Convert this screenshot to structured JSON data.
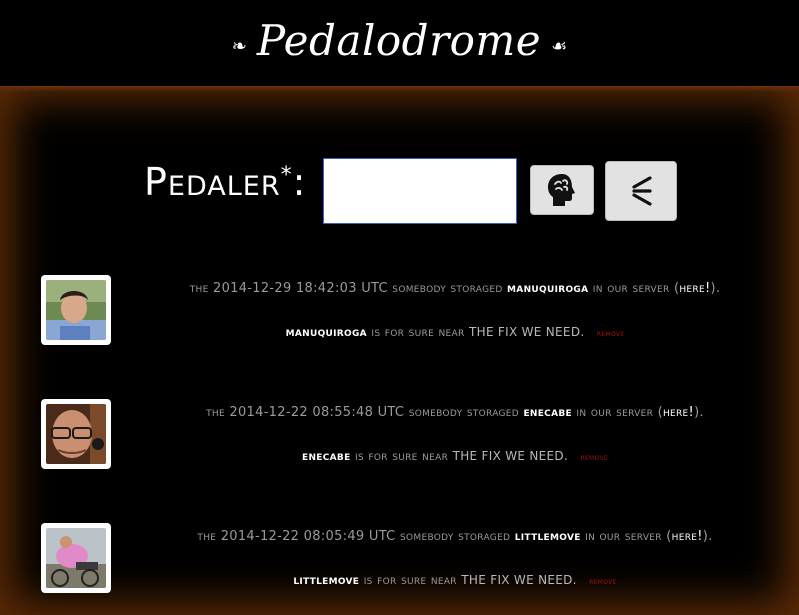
{
  "header": {
    "title": "Pedalodrome",
    "left_ornament": "❧",
    "right_ornament": "☙"
  },
  "form": {
    "label": "Pedaler",
    "required_mark": "*",
    "colon": ":",
    "input_value": "",
    "brain_button_icon": "brain-head-icon",
    "back_button_icon": "chevron-left-icon"
  },
  "entries": [
    {
      "prefix": "the 2014-12-29 18:42:03 UTC somebody storaged",
      "name": "manuquiroga",
      "mid": "in our server (",
      "here_label": "here!",
      "suffix": ").",
      "name2": "manuquiroga",
      "status": "is for sure near",
      "need": "the fix we need.",
      "remove_label": "remove"
    },
    {
      "prefix": "the 2014-12-22 08:55:48 UTC somebody storaged",
      "name": "enecabe",
      "mid": "in our server (",
      "here_label": "here!",
      "suffix": ").",
      "name2": "enecabe",
      "status": "is for sure near",
      "need": "the fix we need.",
      "remove_label": "remove"
    },
    {
      "prefix": "the 2014-12-22 08:05:49 UTC somebody storaged",
      "name": "littlemove",
      "mid": "in our server (",
      "here_label": "here!",
      "suffix": ").",
      "name2": "littlemove",
      "status": "is for sure near",
      "need": "the fix we need.",
      "remove_label": "remove"
    }
  ],
  "colors": {
    "background": "#000000",
    "glow": "#5a2a06",
    "input_border": "#3a5ec8",
    "remove": "#a01010"
  }
}
